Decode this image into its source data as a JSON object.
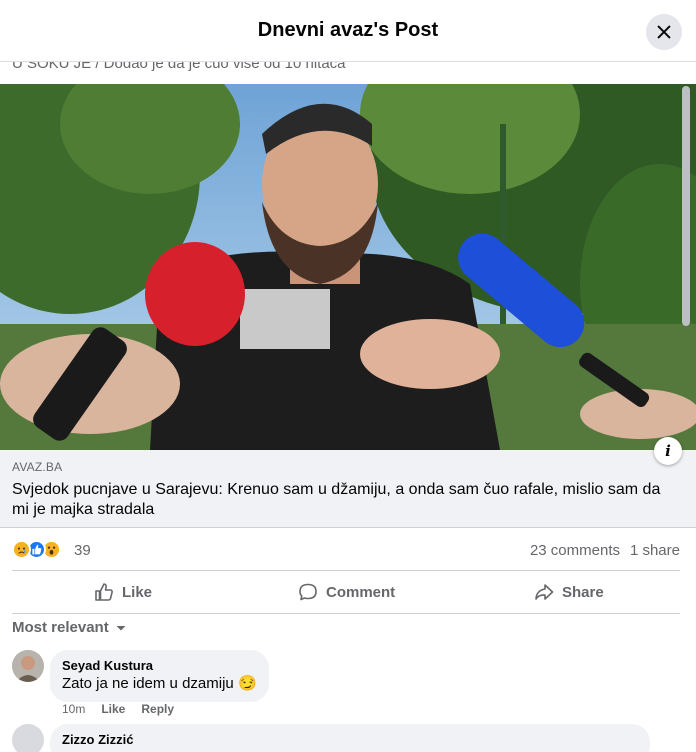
{
  "header": {
    "title": "Dnevni avaz's Post",
    "close_icon": "close-icon"
  },
  "post": {
    "clipped_caption": "U ŠOKU JE / Dodao je da je čuo više od 10 hitaca",
    "link": {
      "domain": "AVAZ.BA",
      "title": "Svjedok pucnjave u Sarajevu: Krenuo sam u džamiju, a onda sam čuo rafale, mislio sam da mi je majka stradala"
    },
    "info_label": "i"
  },
  "stats": {
    "reaction_count": "39",
    "comments": "23 comments",
    "shares": "1 share",
    "reactions": [
      "sad",
      "like",
      "wow"
    ]
  },
  "actions": {
    "like": "Like",
    "comment": "Comment",
    "share": "Share"
  },
  "comments_sort": "Most relevant",
  "comments": [
    {
      "author": "Seyad Kustura",
      "text": "Zato ja ne idem u dzamiju",
      "emoji": "😏",
      "time": "10m",
      "like": "Like",
      "reply": "Reply"
    },
    {
      "author": "Zizzo Zizzić"
    }
  ],
  "colors": {
    "accent": "#1877f2",
    "secondary_text": "#65676b",
    "bubble": "#f0f2f5"
  }
}
